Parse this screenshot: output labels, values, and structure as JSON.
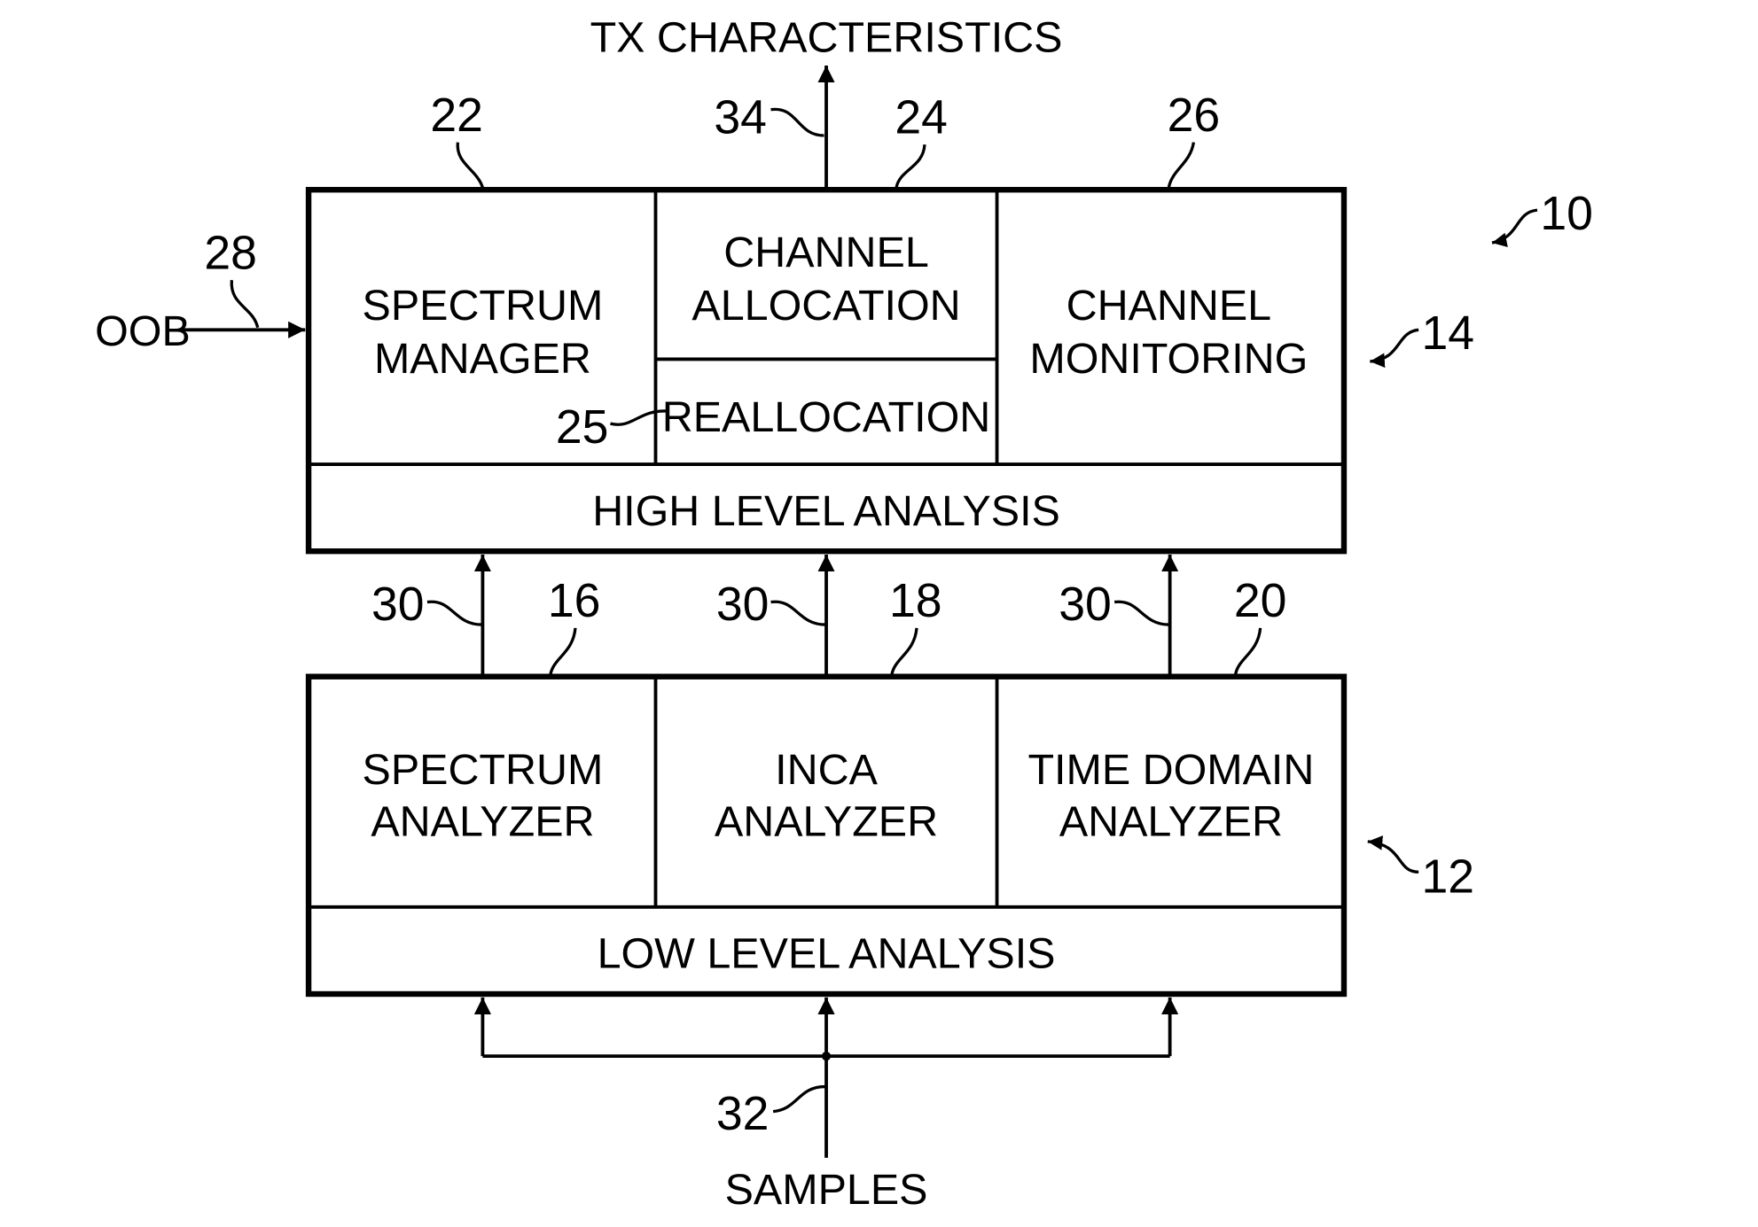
{
  "figure": {
    "output_label": "TX CHARACTERISTICS",
    "input_label": "SAMPLES",
    "side_input_label": "OOB",
    "high_level": {
      "section_label": "HIGH LEVEL ANALYSIS",
      "blocks": [
        {
          "lines": [
            "SPECTRUM",
            "MANAGER"
          ]
        },
        {
          "lines": [
            "CHANNEL",
            "ALLOCATION"
          ]
        },
        {
          "lines": [
            "REALLOCATION"
          ]
        },
        {
          "lines": [
            "CHANNEL",
            "MONITORING"
          ]
        }
      ]
    },
    "low_level": {
      "section_label": "LOW LEVEL ANALYSIS",
      "blocks": [
        {
          "lines": [
            "SPECTRUM",
            "ANALYZER"
          ]
        },
        {
          "lines": [
            "INCA",
            "ANALYZER"
          ]
        },
        {
          "lines": [
            "TIME DOMAIN",
            "ANALYZER"
          ]
        }
      ]
    },
    "refs": {
      "system": "10",
      "low_level_unit": "12",
      "high_level_unit": "14",
      "spectrum_analyzer": "16",
      "inca_analyzer": "18",
      "time_domain_analyzer": "20",
      "spectrum_manager": "22",
      "channel_allocation": "24",
      "reallocation": "25",
      "channel_monitoring": "26",
      "oob_input": "28",
      "analysis_link_1": "30",
      "analysis_link_2": "30",
      "analysis_link_3": "30",
      "samples_input": "32",
      "tx_output": "34"
    }
  }
}
